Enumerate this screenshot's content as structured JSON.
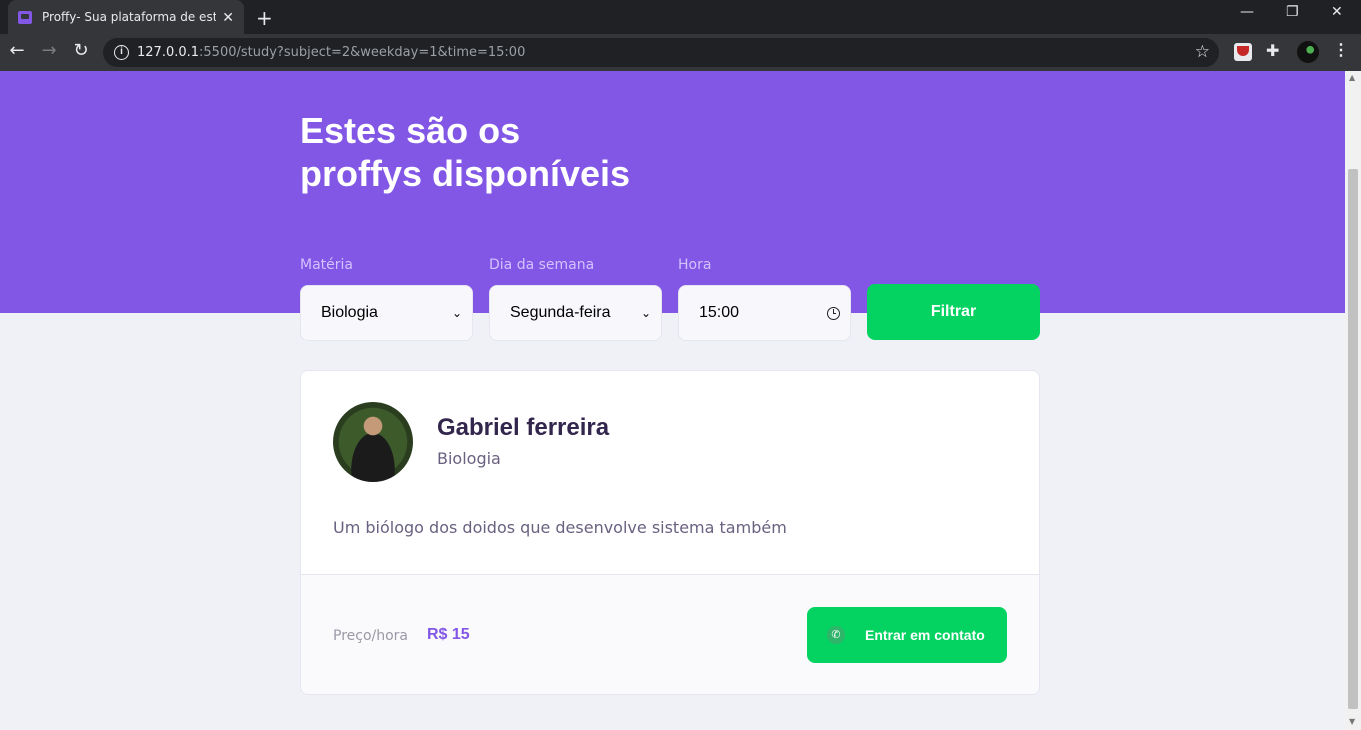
{
  "browser": {
    "tab_title": "Proffy- Sua plataforma de estudos",
    "tab_close": "✕",
    "new_tab": "+",
    "url_host": "127.0.0.1",
    "url_rest": ":5500/study?subject=2&weekday=1&time=15:00",
    "window_controls": [
      "—",
      "❐",
      "✕"
    ]
  },
  "header": {
    "title_line1": "Estes são os",
    "title_line2": "proffys disponíveis"
  },
  "filters": {
    "subject": {
      "label": "Matéria",
      "value": "Biologia"
    },
    "weekday": {
      "label": "Dia da semana",
      "value": "Segunda-feira"
    },
    "time": {
      "label": "Hora",
      "value": "15:00"
    },
    "submit_label": "Filtrar"
  },
  "teacher": {
    "name": "Gabriel ferreira",
    "subject": "Biologia",
    "bio": "Um biólogo dos doidos que desenvolve sistema também",
    "price_label": "Preço/hora",
    "price_value": "R$ 15",
    "contact_label": "Entrar em contato"
  },
  "colors": {
    "primary": "#8257e5",
    "secondary": "#04d361",
    "background": "#f0f0f7",
    "title_text": "#32264d"
  }
}
